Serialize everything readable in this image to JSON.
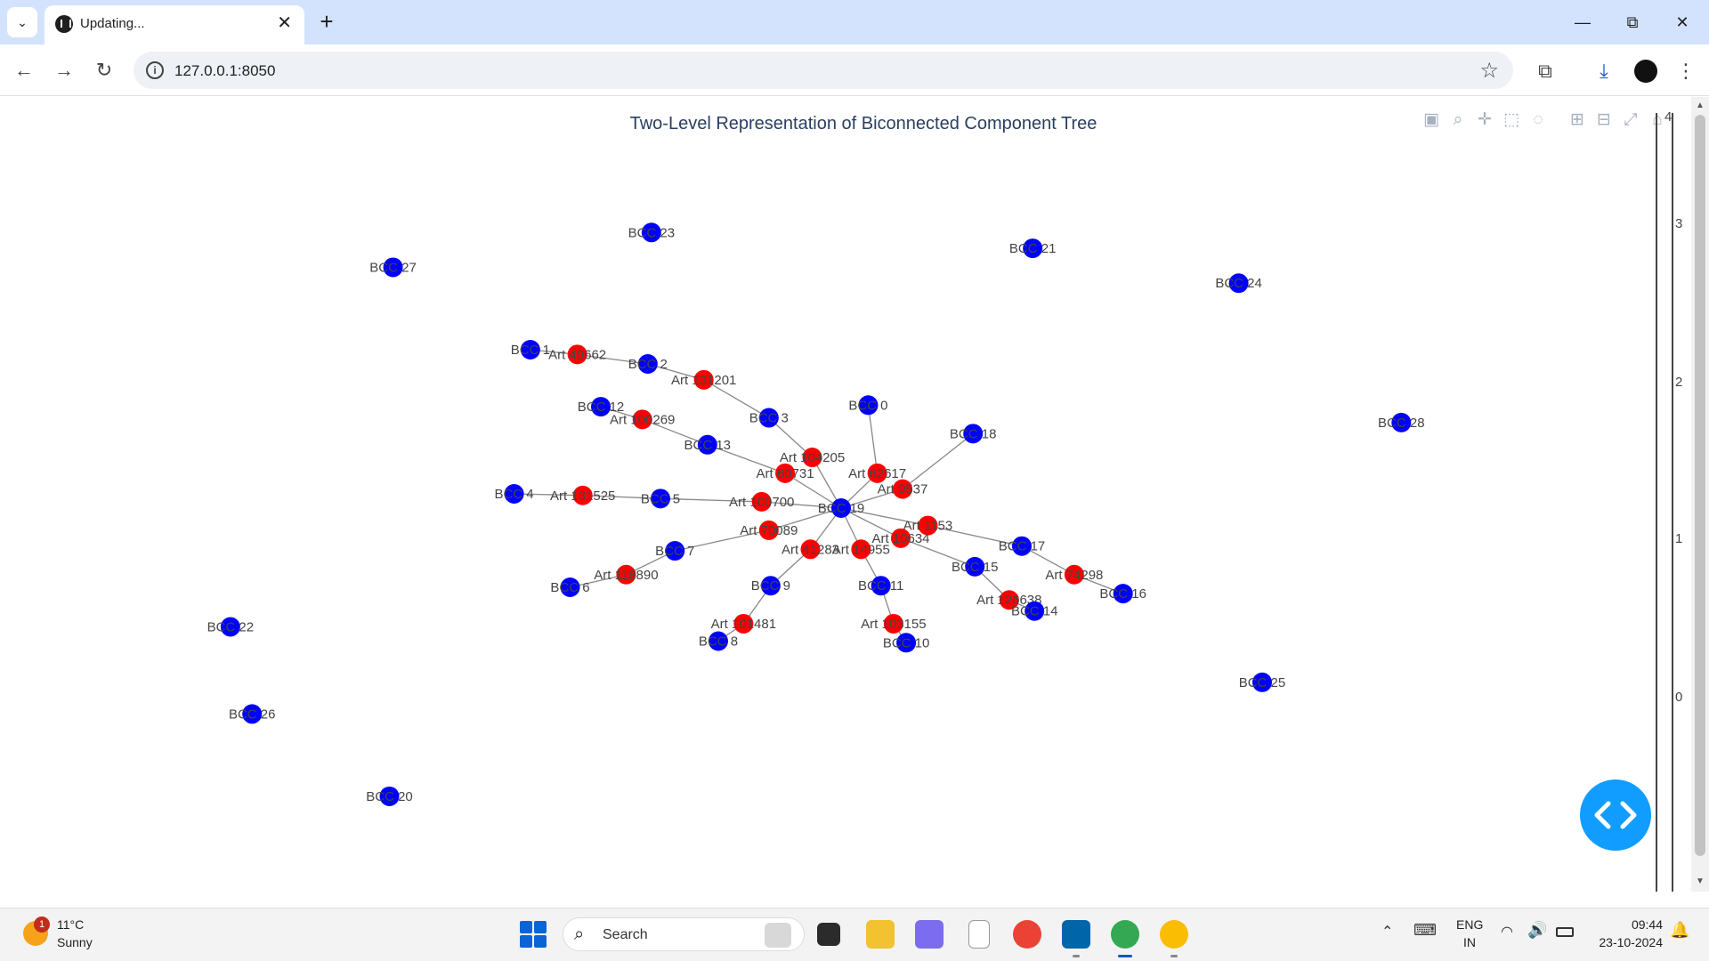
{
  "browser": {
    "tab_title": "Updating...",
    "url": "127.0.0.1:8050"
  },
  "figure": {
    "title": "Two-Level Representation of Biconnected Component Tree",
    "colorbar_ticks": [
      "3",
      "2",
      "1",
      "0"
    ],
    "colorbar_cut_label": "4"
  },
  "chart_data": {
    "type": "scatter",
    "title": "Two-Level Representation of Biconnected Component Tree",
    "grid": false,
    "legend": "none",
    "colors": {
      "bcc": "#0000ff",
      "articulation": "#ff0000",
      "edge": "#888888"
    },
    "bcc_nodes": [
      {
        "label": "BCC 0",
        "x": 0.15,
        "y": 0.65
      },
      {
        "label": "BCC 1",
        "x": -1.72,
        "y": 1.0
      },
      {
        "label": "BCC 2",
        "x": -1.07,
        "y": 0.91
      },
      {
        "label": "BCC 3",
        "x": -0.4,
        "y": 0.57
      },
      {
        "label": "BCC 4",
        "x": -1.81,
        "y": 0.09
      },
      {
        "label": "BCC 5",
        "x": -1.0,
        "y": 0.06
      },
      {
        "label": "BCC 6",
        "x": -1.5,
        "y": -0.5
      },
      {
        "label": "BCC 7",
        "x": -0.92,
        "y": -0.27
      },
      {
        "label": "BCC 8",
        "x": -0.68,
        "y": -0.84
      },
      {
        "label": "BCC 9",
        "x": -0.39,
        "y": -0.49
      },
      {
        "label": "BCC 10",
        "x": 0.36,
        "y": -0.85
      },
      {
        "label": "BCC 11",
        "x": 0.22,
        "y": -0.49
      },
      {
        "label": "BCC 12",
        "x": -1.33,
        "y": 0.64
      },
      {
        "label": "BCC 13",
        "x": -0.74,
        "y": 0.4
      },
      {
        "label": "BCC 14",
        "x": 1.07,
        "y": -0.65
      },
      {
        "label": "BCC 15",
        "x": 0.74,
        "y": -0.37
      },
      {
        "label": "BCC 16",
        "x": 1.56,
        "y": -0.54
      },
      {
        "label": "BCC 17",
        "x": 1.0,
        "y": -0.24
      },
      {
        "label": "BCC 18",
        "x": 0.73,
        "y": 0.47
      },
      {
        "label": "BCC 19",
        "x": 0.0,
        "y": 0.0
      },
      {
        "label": "BCC 20",
        "x": -2.5,
        "y": -1.82
      },
      {
        "label": "BCC 21",
        "x": 1.06,
        "y": 1.64
      },
      {
        "label": "BCC 22",
        "x": -3.38,
        "y": -0.75
      },
      {
        "label": "BCC 23",
        "x": -1.05,
        "y": 1.74
      },
      {
        "label": "BCC 24",
        "x": 2.2,
        "y": 1.42
      },
      {
        "label": "BCC 25",
        "x": 2.33,
        "y": -1.1
      },
      {
        "label": "BCC 26",
        "x": -3.26,
        "y": -1.3
      },
      {
        "label": "BCC 27",
        "x": -2.48,
        "y": 1.52
      },
      {
        "label": "BCC 28",
        "x": 3.1,
        "y": 0.54
      }
    ],
    "articulation_nodes": [
      {
        "label": "Art 40662",
        "x": -1.46,
        "y": 0.97
      },
      {
        "label": "Art 131201",
        "x": -0.76,
        "y": 0.81
      },
      {
        "label": "Art 100269",
        "x": -1.1,
        "y": 0.56
      },
      {
        "label": "Art 104205",
        "x": -0.16,
        "y": 0.32
      },
      {
        "label": "Art 60731",
        "x": -0.31,
        "y": 0.22
      },
      {
        "label": "Art 62617",
        "x": 0.2,
        "y": 0.22
      },
      {
        "label": "Art 9537",
        "x": 0.34,
        "y": 0.12
      },
      {
        "label": "Art 131525",
        "x": -1.43,
        "y": 0.08
      },
      {
        "label": "Art 100700",
        "x": -0.44,
        "y": 0.04
      },
      {
        "label": "Art 1153",
        "x": 0.48,
        "y": -0.11
      },
      {
        "label": "Art 10634",
        "x": 0.33,
        "y": -0.19
      },
      {
        "label": "Art 70089",
        "x": -0.4,
        "y": -0.14
      },
      {
        "label": "Art 41283",
        "x": -0.17,
        "y": -0.26
      },
      {
        "label": "Art 14955",
        "x": 0.11,
        "y": -0.26
      },
      {
        "label": "Art 118890",
        "x": -1.19,
        "y": -0.42
      },
      {
        "label": "Art 74298",
        "x": 1.29,
        "y": -0.42
      },
      {
        "label": "Art 126638",
        "x": 0.93,
        "y": -0.58
      },
      {
        "label": "Art 101481",
        "x": -0.54,
        "y": -0.73
      },
      {
        "label": "Art 103155",
        "x": 0.29,
        "y": -0.73
      }
    ],
    "edges": [
      [
        "BCC 1",
        "Art 40662"
      ],
      [
        "Art 40662",
        "BCC 2"
      ],
      [
        "BCC 2",
        "Art 131201"
      ],
      [
        "Art 131201",
        "BCC 3"
      ],
      [
        "BCC 3",
        "Art 104205"
      ],
      [
        "Art 104205",
        "BCC 19"
      ],
      [
        "BCC 12",
        "Art 100269"
      ],
      [
        "Art 100269",
        "BCC 13"
      ],
      [
        "BCC 13",
        "Art 60731"
      ],
      [
        "Art 60731",
        "BCC 19"
      ],
      [
        "BCC 0",
        "Art 62617"
      ],
      [
        "Art 62617",
        "BCC 19"
      ],
      [
        "BCC 18",
        "Art 9537"
      ],
      [
        "Art 9537",
        "BCC 19"
      ],
      [
        "BCC 4",
        "Art 131525"
      ],
      [
        "Art 131525",
        "BCC 5"
      ],
      [
        "BCC 5",
        "Art 100700"
      ],
      [
        "Art 100700",
        "BCC 19"
      ],
      [
        "BCC 19",
        "Art 1153"
      ],
      [
        "Art 1153",
        "BCC 17"
      ],
      [
        "BCC 17",
        "Art 74298"
      ],
      [
        "Art 74298",
        "BCC 16"
      ],
      [
        "BCC 19",
        "Art 10634"
      ],
      [
        "Art 10634",
        "BCC 15"
      ],
      [
        "BCC 15",
        "Art 126638"
      ],
      [
        "Art 126638",
        "BCC 14"
      ],
      [
        "BCC 19",
        "Art 70089"
      ],
      [
        "Art 70089",
        "BCC 7"
      ],
      [
        "BCC 7",
        "Art 118890"
      ],
      [
        "Art 118890",
        "BCC 6"
      ],
      [
        "BCC 19",
        "Art 41283"
      ],
      [
        "Art 41283",
        "BCC 9"
      ],
      [
        "BCC 9",
        "Art 101481"
      ],
      [
        "Art 101481",
        "BCC 8"
      ],
      [
        "BCC 19",
        "Art 14955"
      ],
      [
        "Art 14955",
        "BCC 11"
      ],
      [
        "BCC 11",
        "Art 103155"
      ],
      [
        "Art 103155",
        "BCC 10"
      ]
    ]
  },
  "taskbar": {
    "weather_badge": "1",
    "temperature": "11°C",
    "condition": "Sunny",
    "search_label": "Search",
    "lang_1": "ENG",
    "lang_2": "IN",
    "time": "09:44",
    "date": "23-10-2024"
  }
}
